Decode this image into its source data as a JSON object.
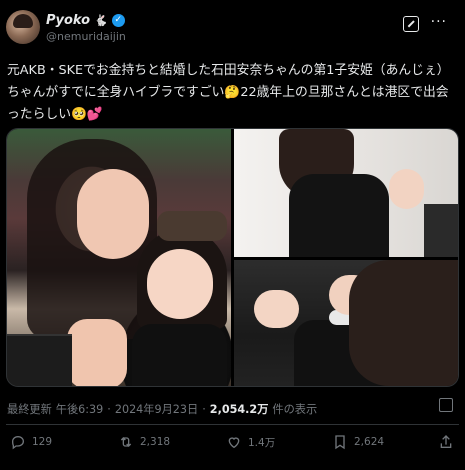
{
  "author": {
    "display_name": "Pyoko",
    "name_emoji": "🐇",
    "handle": "@nemuridaijin"
  },
  "tweet": {
    "text": "元AKB・SKEでお金持ちと結婚した石田安奈ちゃんの第1子安姫（あんじぇ）ちゃんがすでに全身ハイブラですごい🤔22歳年上の旦那さんとは港区で出会ったらしい🥺💕"
  },
  "meta": {
    "label": "最終更新",
    "time": "午後6:39",
    "separator": "·",
    "date": "2024年9月23日",
    "views_count": "2,054.2万",
    "views_label": "件の表示"
  },
  "actions": {
    "reply_count": "129",
    "retweet_count": "2,318",
    "like_count": "1.4万",
    "bookmark_count": "2,624"
  },
  "colors": {
    "background": "#000000",
    "text": "#e7e9ea",
    "muted": "#71767b",
    "verified": "#1d9bf0",
    "border": "#2f3336"
  }
}
